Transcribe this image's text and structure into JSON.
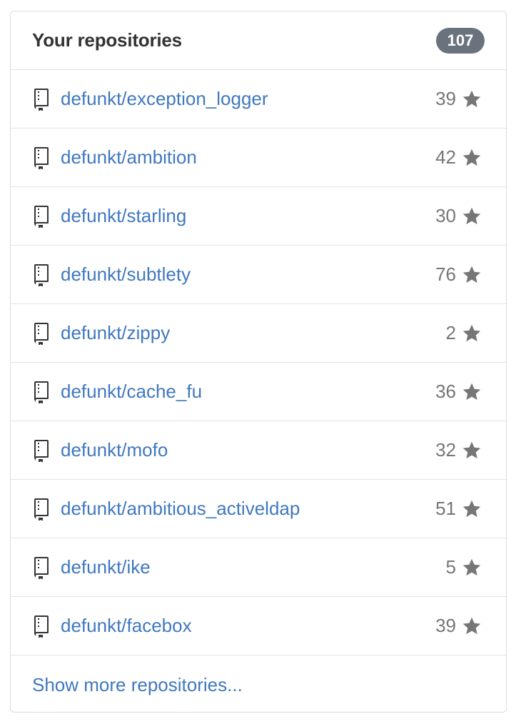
{
  "panel": {
    "title": "Your repositories",
    "count": "107"
  },
  "repositories": [
    {
      "name": "defunkt/exception_logger",
      "stars": "39"
    },
    {
      "name": "defunkt/ambition",
      "stars": "42"
    },
    {
      "name": "defunkt/starling",
      "stars": "30"
    },
    {
      "name": "defunkt/subtlety",
      "stars": "76"
    },
    {
      "name": "defunkt/zippy",
      "stars": "2"
    },
    {
      "name": "defunkt/cache_fu",
      "stars": "36"
    },
    {
      "name": "defunkt/mofo",
      "stars": "32"
    },
    {
      "name": "defunkt/ambitious_activeldap",
      "stars": "51"
    },
    {
      "name": "defunkt/ike",
      "stars": "5"
    },
    {
      "name": "defunkt/facebox",
      "stars": "39"
    }
  ],
  "footer": {
    "show_more_label": "Show more repositories..."
  },
  "icons": {
    "repo": "repo-icon",
    "star": "star-icon"
  },
  "colors": {
    "link": "#4078c0",
    "badge": "#6a737d",
    "muted": "#767676",
    "title": "#333333"
  }
}
